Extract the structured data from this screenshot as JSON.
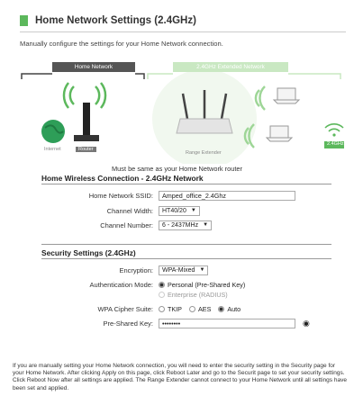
{
  "page": {
    "title": "Home Network Settings (2.4GHz)",
    "subtitle": "Manually configure the settings for your Home Network connection."
  },
  "diagram": {
    "home_label": "Home Network",
    "extended_label": "2.4GHz Extended Network",
    "internet_caption": "Internet",
    "router_caption": "Router",
    "extender_caption": "Range Extender",
    "band_caption": "2.4GHz",
    "note": "Must be same as your Home Network router"
  },
  "wireless": {
    "heading": "Home Wireless Connection - 2.4GHz Network",
    "ssid_label": "Home Network SSID:",
    "ssid_value": "Amped_office_2.4Ghz",
    "width_label": "Channel Width:",
    "width_value": "HT40/20",
    "channel_label": "Channel Number:",
    "channel_value": "6 - 2437MHz"
  },
  "security": {
    "heading": "Security Settings (2.4GHz)",
    "encryption_label": "Encryption:",
    "encryption_value": "WPA-Mixed",
    "auth_label": "Authentication Mode:",
    "auth_personal": "Personal (Pre-Shared Key)",
    "auth_enterprise": "Enterprise (RADIUS)",
    "cipher_label": "WPA Cipher Suite:",
    "cipher_tkip": "TKIP",
    "cipher_aes": "AES",
    "cipher_auto": "Auto",
    "psk_label": "Pre-Shared Key:",
    "psk_value": "••••••••"
  },
  "footer": {
    "text": "If you are manually setting your Home Network connection, you will need to enter the security setting in the Security page for your Home Network. After clicking Apply on this page, click Reboot Later and go to the Securit page to set your security settings. Click Reboot Now after all settings are applied. The Range Extender cannot connect to your Home Network until all settings have been set and applied."
  },
  "colors": {
    "accent_green": "#5cb85c",
    "light_green": "#c9e8c2"
  }
}
